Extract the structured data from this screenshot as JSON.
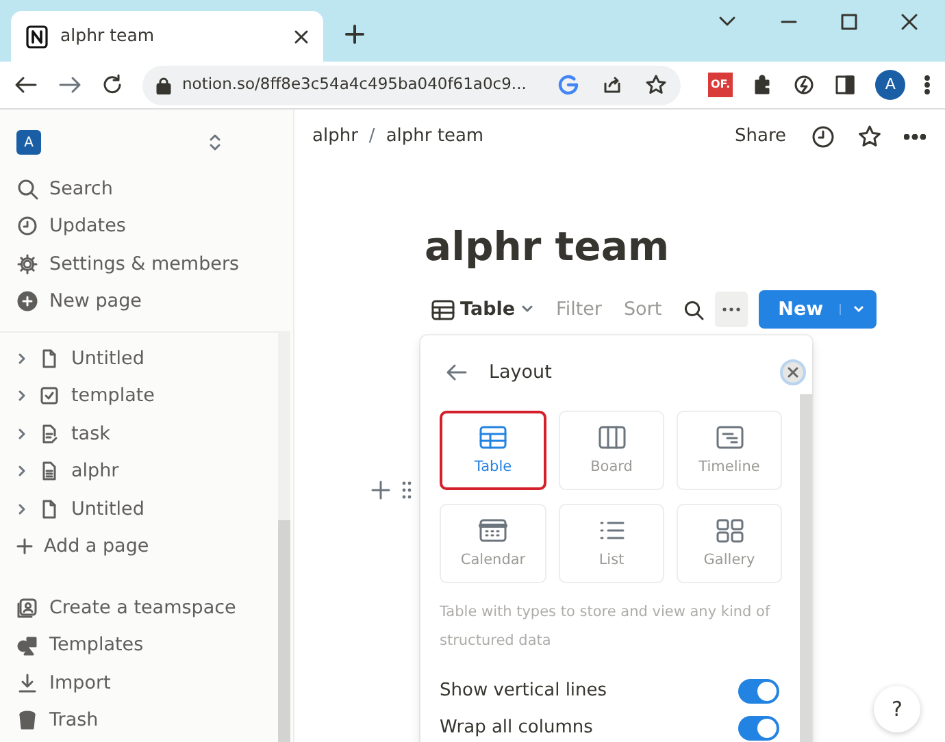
{
  "browser": {
    "tab_title": "alphr team",
    "url": "notion.so/8ff8e3c54a4c495ba040f61a0c9...",
    "extension_badge": "OF.",
    "profile_letter": "A"
  },
  "sidebar": {
    "workspace_letter": "A",
    "menu": [
      {
        "label": "Search",
        "kind": "search"
      },
      {
        "label": "Updates",
        "kind": "clock"
      },
      {
        "label": "Settings & members",
        "kind": "gear"
      },
      {
        "label": "New page",
        "kind": "plus-circle"
      }
    ],
    "pages": [
      {
        "label": "Untitled",
        "kind": "page"
      },
      {
        "label": "template",
        "kind": "checkbox"
      },
      {
        "label": "task",
        "kind": "page-edit"
      },
      {
        "label": "alphr",
        "kind": "doc"
      },
      {
        "label": "Untitled",
        "kind": "page"
      }
    ],
    "add_page": "Add a page",
    "bottom": [
      {
        "label": "Create a teamspace",
        "kind": "team"
      },
      {
        "label": "Templates",
        "kind": "shapes"
      },
      {
        "label": "Import",
        "kind": "download"
      },
      {
        "label": "Trash",
        "kind": "trash"
      }
    ]
  },
  "page": {
    "breadcrumbs": [
      "alphr",
      "alphr team"
    ],
    "breadcrumb_separator": "/",
    "share": "Share",
    "title": "alphr team",
    "toolbar": {
      "view": "Table",
      "filter": "Filter",
      "sort": "Sort",
      "new": "New"
    }
  },
  "layout_panel": {
    "title": "Layout",
    "options": [
      {
        "label": "Table",
        "kind": "table",
        "selected": true
      },
      {
        "label": "Board",
        "kind": "board",
        "selected": false
      },
      {
        "label": "Timeline",
        "kind": "timeline",
        "selected": false
      },
      {
        "label": "Calendar",
        "kind": "calendar",
        "selected": false
      },
      {
        "label": "List",
        "kind": "list",
        "selected": false
      },
      {
        "label": "Gallery",
        "kind": "gallery",
        "selected": false
      }
    ],
    "description": "Table with types to store and view any kind of structured data",
    "toggles": [
      {
        "label": "Show vertical lines",
        "on": true
      },
      {
        "label": "Wrap all columns",
        "on": true
      }
    ]
  },
  "help": "?"
}
